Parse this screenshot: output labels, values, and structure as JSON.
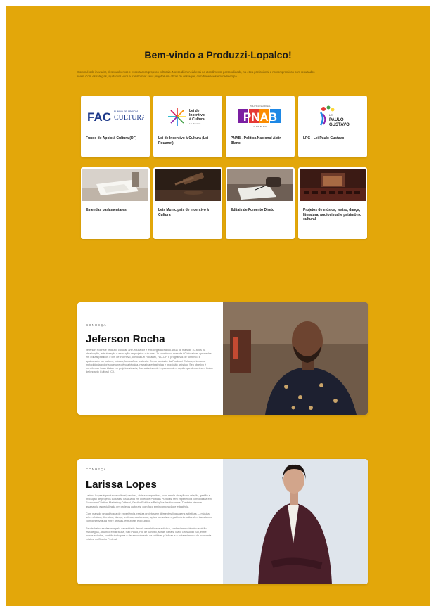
{
  "header": {
    "title": "Bem-vindo a Produzzi-Lopalco!",
    "intro": "Com método inovador, desenvolvemos e executamos projetos culturais. Nosso diferencial está no atendimento personalizado, na ética profissional e no compromisso com resultados reais. Com estratégias, ajudamos você a transformar seus projetos em obras de destaque, com benefícios em cada etapa."
  },
  "cards": [
    {
      "label": "Fundo de Apoio à Cultura (DF)",
      "logo": "FAC Fundo de Apoio à Cultura"
    },
    {
      "label": "Lei de Incentivo à Cultura (Lei Rouanet)",
      "logo": "Lei de Incentivo à Cultura"
    },
    {
      "label": "PNAB - Política Nacional Aldir Blanc",
      "logo": "PNAB"
    },
    {
      "label": "LPG - Lei Paulo Gustavo",
      "logo": "LPG Paulo Gustavo"
    },
    {
      "label": "Emendas parlamentares"
    },
    {
      "label": "Leis Municipais de Incentivo à Cultura"
    },
    {
      "label": "Editais de Fomento Direto"
    },
    {
      "label": "Projetos de música, teatro, dança, literatura, audiovisual e patrimônio cultural"
    }
  ],
  "logo_text": {
    "fac_big": "FAC",
    "fac_small1": "FUNDO DE APOIO À",
    "fac_small2": "CULTURA",
    "rouanet_1": "Lei de",
    "rouanet_2": "Incentivo",
    "rouanet_3": "à Cultura",
    "rouanet_4": "Lei Rouanet",
    "pnab_top": "POLÍTICA NACIONAL",
    "pnab_big": "PNAB",
    "pnab_bottom": "ALDIR BLANC",
    "lpg_1": "LEI",
    "lpg_2": "PAULO",
    "lpg_3": "GUSTAVO"
  },
  "profiles": [
    {
      "kicker": "CONHEÇA",
      "name": "Jeferson Rocha",
      "bio": "Jeferson Rocha é produtor cultural, arte-educador e estrategista criativo. Atua há mais de 10 anos na idealização, estruturação e execução de projetos culturais. Já coordenou mais de 60 iniciativas aprovadas em editais públicos e leis de incentivo, como a Lei Rouanet, FAC-DF, e programas de fomento. É apaixonado por cultura, música, formação e festivais. Como fundador da Produzzi Cultura, criou uma metodologia própria que une ciência técnica, narrativa estratégica e propósito artístico. Seu objetivo é transformar boas ideias em projetos viáveis, financiáveis e de impacto real — aquilo que denominam Caixa de Impacto Cultural (CI)."
    },
    {
      "kicker": "CONHEÇA",
      "name": "Larissa Lopes",
      "bio": "Larissa Lopes é produtora cultural, cantora, atriz e compositora, com ampla atuação na criação, gestão e produção de projetos culturais. Graduada em Direito e Políticas Públicas, tem experiência consolidada em Economia Criativa, Marketing Cultural, Gestão Pública e Relações Institucionais. Também oferece assessoria especializada em projetos culturais, com foco em incorporação e estratégia.\n\nCom mais de uma década de experiência, realiza projetos em diferentes linguagens artísticas — música, artes cênicas, literatura, dança, festivais, audiovisual, ações formativas e patrimônio cultural — transitando com desenvoltura entre artistas, estruturas e o público.\n\nSeu trabalho se destaca pela capacidade de unir sensibilidade artística, conhecimento técnico e visão estratégica, atuando em Brasília, São Paulo, Rio de Janeiro, Minas Gerais, Mato Grosso do Sul, entre outros estados, contribuindo para o desenvolvimento de políticas públicas e o fortalecimento da economia criativa no Distrito Federal."
    }
  ],
  "colors": {
    "page_background": "#e3a70a",
    "card_background": "#ffffff"
  }
}
